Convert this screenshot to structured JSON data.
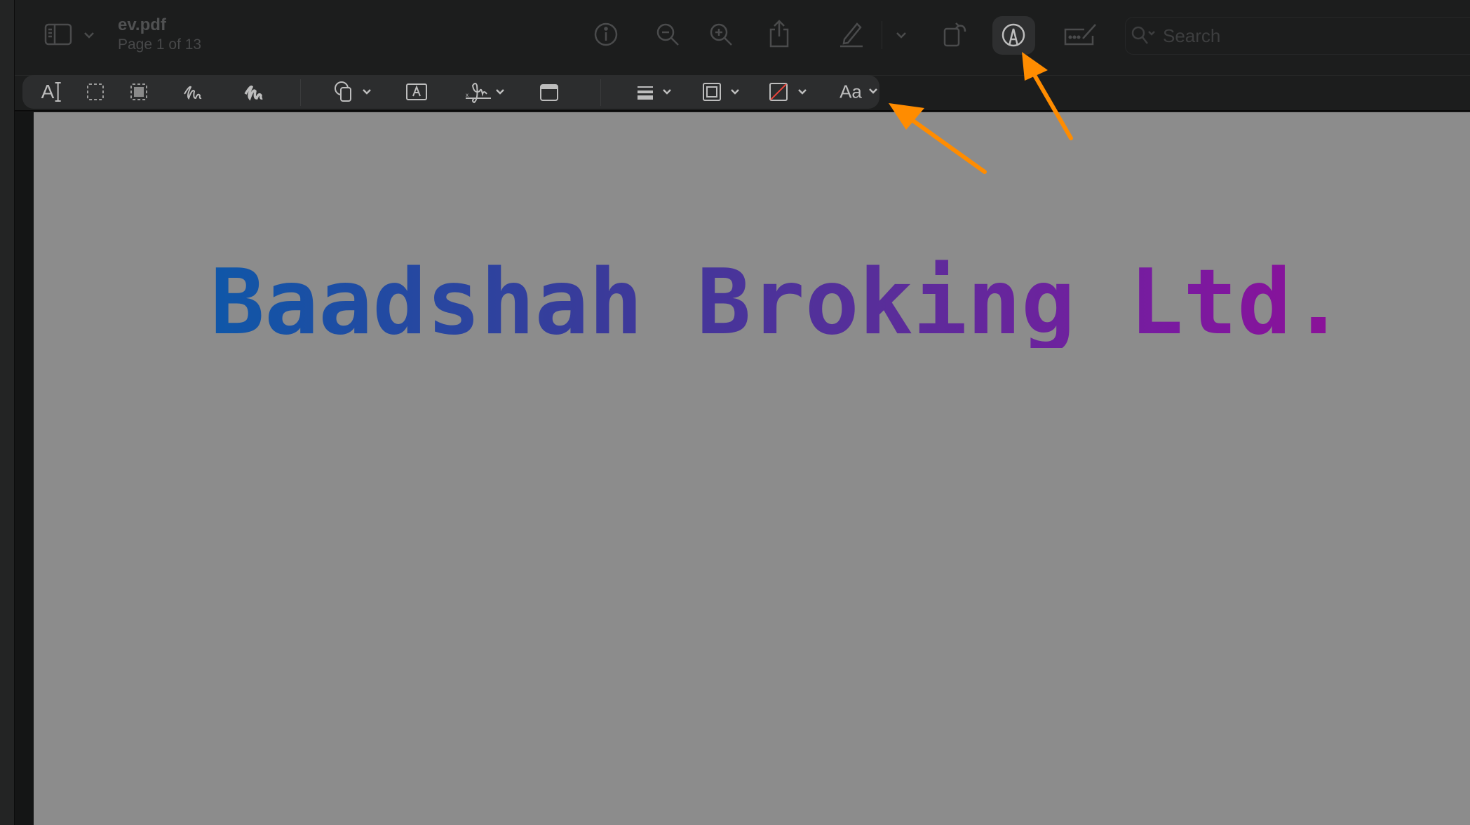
{
  "document": {
    "filename": "ev.pdf",
    "page_indicator": "Page 1 of 13"
  },
  "toolbar": {
    "icons": [
      "sidebar-toggle-icon",
      "info-icon",
      "zoom-out-icon",
      "zoom-in-icon",
      "share-icon",
      "highlight-pen-icon",
      "rotate-icon",
      "markup-icon",
      "form-filling-icon"
    ],
    "markup_active": true,
    "search_placeholder": "Search"
  },
  "markup_toolbar": {
    "tools": [
      "text-selection",
      "rectangular-selection",
      "smart-lasso",
      "sketch",
      "draw",
      "shapes",
      "text-box",
      "sign",
      "note",
      "shape-style",
      "border-color",
      "fill-color",
      "text-style"
    ],
    "text_style_label": "Aa",
    "text_selection_label": "A"
  },
  "page_content": {
    "logo_text": "Baadshah Broking Ltd."
  },
  "colors": {
    "annotation_arrow": "#ff8c00",
    "page_bg": "#8c8c8c",
    "logo_start": "#0f57a8",
    "logo_end": "#8c1098"
  }
}
